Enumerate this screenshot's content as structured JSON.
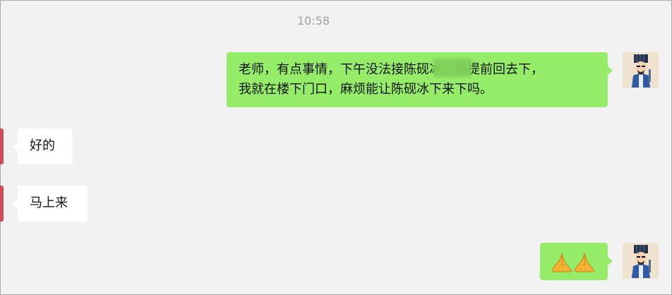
{
  "chat": {
    "timestamp": "10:58",
    "messages": [
      {
        "side": "out",
        "lines": [
          "老师，有点事情，下午没法接陈砚冰，要提前回去下，",
          "我就在楼下门口，麻烦能让陈砚冰下来下吗。"
        ]
      },
      {
        "side": "in",
        "text": "好的"
      },
      {
        "side": "in",
        "text": "马上来"
      },
      {
        "side": "out",
        "emoji": "praying-hands-emoji"
      }
    ]
  },
  "colors": {
    "background": "#f2f2f2",
    "outgoing_bubble": "#95ec69",
    "incoming_bubble": "#ffffff",
    "timestamp_text": "#a0a0a0"
  }
}
